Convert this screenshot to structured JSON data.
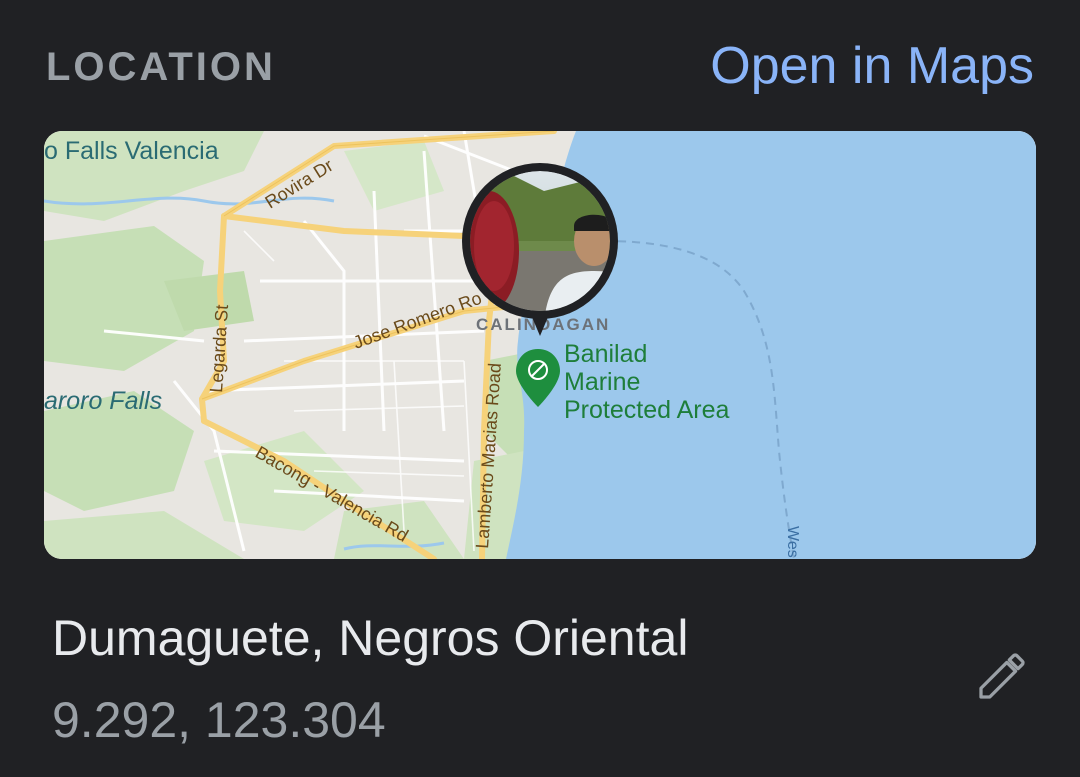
{
  "header": {
    "section_label": "LOCATION",
    "open_maps_label": "Open in Maps"
  },
  "map": {
    "labels": {
      "falls_valencia": "o Falls Valencia",
      "rovira": "Rovira Dr",
      "legarda": "Legarda St",
      "jose_romero": "Jose Romero Ro",
      "casaroro": "aroro Falls",
      "bacong": "Bacong - Valencia Rd",
      "lamberto": "Lamberto Macias Road",
      "calindagan": "CALINDAGAN",
      "poi_line1": "Banilad",
      "poi_line2": "Marine",
      "poi_line3": "Protected Area",
      "west": "Wes"
    },
    "colors": {
      "water": "#9cc8ec",
      "land": "#e8e6e1",
      "green": "#c6dfb6",
      "road": "#f6d27a",
      "poi": "#1e8e3e"
    }
  },
  "location": {
    "name": "Dumaguete, Negros Oriental",
    "coordinates": "9.292, 123.304"
  },
  "icons": {
    "edit": "pencil-icon"
  }
}
